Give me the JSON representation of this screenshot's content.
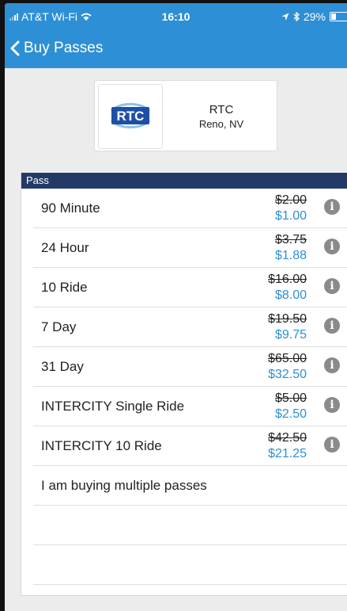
{
  "status_bar": {
    "carrier": "AT&T Wi-Fi",
    "time": "16:10",
    "battery_percent": "29%",
    "battery_level": 0.29
  },
  "nav": {
    "back_label": "Buy Passes"
  },
  "agency": {
    "logo_text": "RTC",
    "name": "RTC",
    "location": "Reno, NV"
  },
  "pass_list": {
    "header": "Pass",
    "items": [
      {
        "name": "90 Minute",
        "old_price": "$2.00",
        "new_price": "$1.00"
      },
      {
        "name": "24 Hour",
        "old_price": "$3.75",
        "new_price": "$1.88"
      },
      {
        "name": "10 Ride",
        "old_price": "$16.00",
        "new_price": "$8.00"
      },
      {
        "name": "7 Day",
        "old_price": "$19.50",
        "new_price": "$9.75"
      },
      {
        "name": "31 Day",
        "old_price": "$65.00",
        "new_price": "$32.50"
      },
      {
        "name": "INTERCITY Single Ride",
        "old_price": "$5.00",
        "new_price": "$2.50"
      },
      {
        "name": "INTERCITY 10 Ride",
        "old_price": "$42.50",
        "new_price": "$21.25"
      }
    ],
    "multiple_label": "I am buying multiple passes"
  },
  "colors": {
    "accent": "#2d8fd5",
    "header_navy": "#243a66",
    "logo_blue": "#1d4fa6"
  }
}
